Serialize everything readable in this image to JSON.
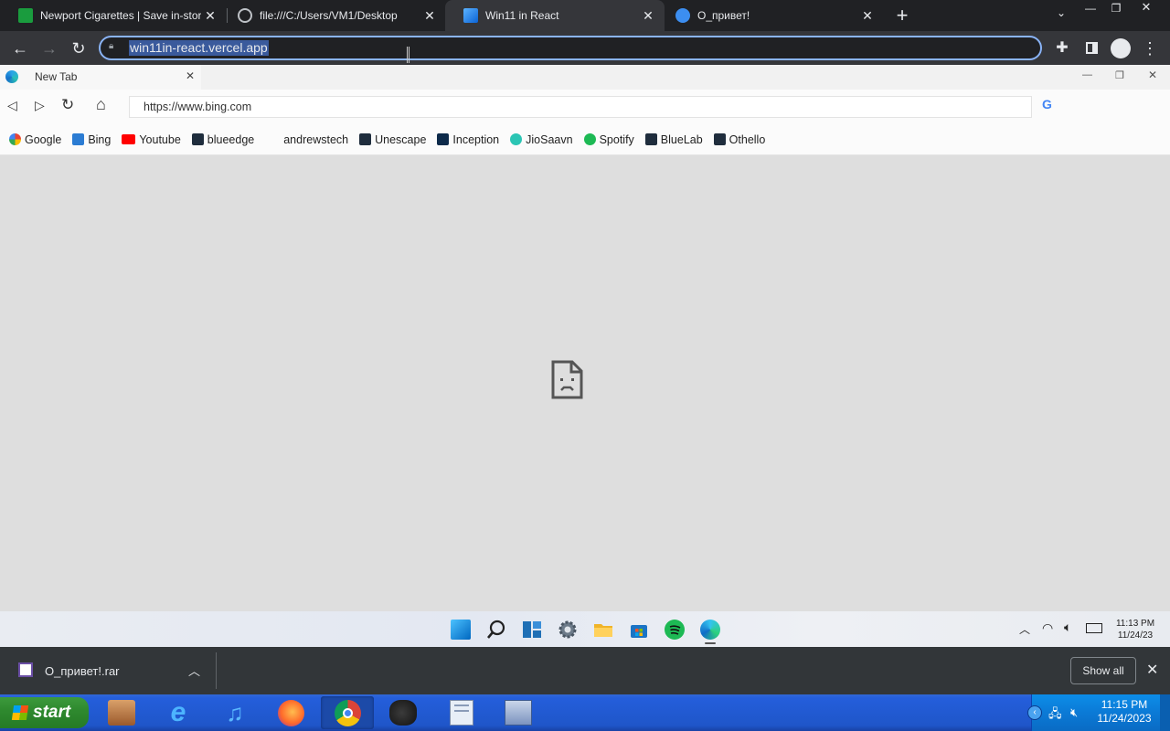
{
  "browser": {
    "tabs": [
      {
        "title": "Newport Cigarettes | Save in-store v",
        "active": false
      },
      {
        "title": "file:///C:/Users/VM1/Desktop",
        "active": false
      },
      {
        "title": "Win11 in React",
        "active": true
      },
      {
        "title": "O_привет!",
        "active": false
      }
    ],
    "url": "win11in-react.vercel.app"
  },
  "app": {
    "tab_title": "New Tab",
    "address": "https://www.bing.com",
    "bookmarks": [
      "Google",
      "Bing",
      "Youtube",
      "blueedge",
      "andrewstech",
      "Unescape",
      "Inception",
      "JioSaavn",
      "Spotify",
      "BlueLab",
      "Othello"
    ],
    "taskbar": {
      "time": "11:13 PM",
      "date": "11/24/23"
    }
  },
  "download": {
    "filename": "O_привет!.rar",
    "show_all": "Show all"
  },
  "xp": {
    "start": "start",
    "time": "11:15 PM",
    "date": "11/24/2023"
  },
  "colors": {
    "chrome_dark": "#202124",
    "accent": "#8ab4f8",
    "xp_blue": "#245edb",
    "xp_green": "#2f8a2f"
  }
}
